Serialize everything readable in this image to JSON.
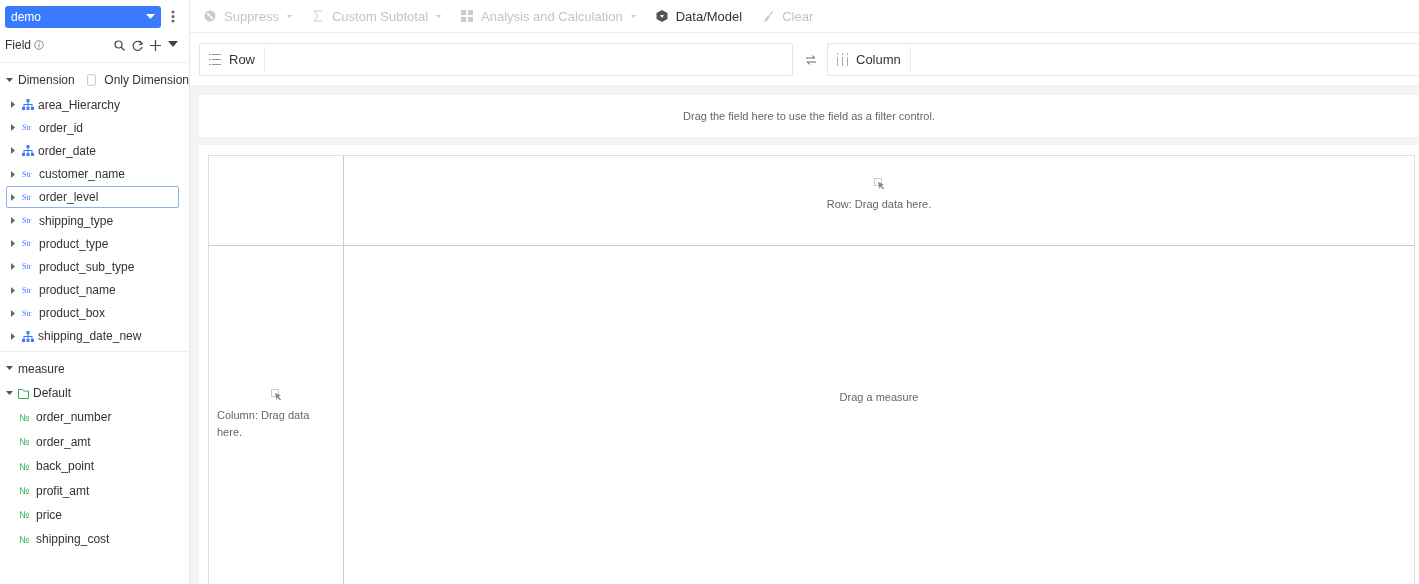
{
  "dataset": {
    "value": "demo"
  },
  "toolbar": [
    {
      "label": "Suppress",
      "kind": "menu",
      "disabled": true
    },
    {
      "label": "Custom Subtotal",
      "kind": "menu",
      "disabled": true
    },
    {
      "label": "Analysis and Calculation",
      "kind": "menu",
      "disabled": true
    },
    {
      "label": "Data/Model",
      "kind": "button",
      "disabled": false
    },
    {
      "label": "Clear",
      "kind": "button",
      "disabled": true
    }
  ],
  "field_panel": {
    "title": "Field"
  },
  "dimension": {
    "label": "Dimension",
    "expanded": true,
    "only_dimension": {
      "label": "Only Dimension",
      "checked": false
    },
    "items": [
      {
        "name": "area_Hierarchy",
        "kind": "hierarchy",
        "expanded": false,
        "selected": false
      },
      {
        "name": "order_id",
        "kind": "string",
        "type_mark": "Str",
        "expanded": false,
        "selected": false
      },
      {
        "name": "order_date",
        "kind": "hierarchy",
        "expanded": false,
        "selected": false
      },
      {
        "name": "customer_name",
        "kind": "string",
        "type_mark": "Str",
        "expanded": false,
        "selected": false
      },
      {
        "name": "order_level",
        "kind": "string",
        "type_mark": "Str",
        "expanded": false,
        "selected": true
      },
      {
        "name": "shipping_type",
        "kind": "string",
        "type_mark": "Str",
        "expanded": false,
        "selected": false
      },
      {
        "name": "product_type",
        "kind": "string",
        "type_mark": "Str",
        "expanded": false,
        "selected": false
      },
      {
        "name": "product_sub_type",
        "kind": "string",
        "type_mark": "Str",
        "expanded": false,
        "selected": false
      },
      {
        "name": "product_name",
        "kind": "string",
        "type_mark": "Str",
        "expanded": false,
        "selected": false
      },
      {
        "name": "product_box",
        "kind": "string",
        "type_mark": "Str",
        "expanded": false,
        "selected": false
      },
      {
        "name": "shipping_date_new",
        "kind": "hierarchy",
        "expanded": false,
        "selected": false
      }
    ]
  },
  "measure": {
    "label": "measure",
    "expanded": true,
    "folders": [
      {
        "name": "Default",
        "expanded": true,
        "items": [
          {
            "name": "order_number",
            "type_mark": "№"
          },
          {
            "name": "order_amt",
            "type_mark": "№"
          },
          {
            "name": "back_point",
            "type_mark": "№"
          },
          {
            "name": "profit_amt",
            "type_mark": "№"
          },
          {
            "name": "price",
            "type_mark": "№"
          },
          {
            "name": "shipping_cost",
            "type_mark": "№"
          }
        ]
      }
    ]
  },
  "shelves": {
    "row": {
      "label": "Row"
    },
    "column": {
      "label": "Column"
    }
  },
  "filter_hint": "Drag the field here to use the field as a filter control.",
  "pivot": {
    "row_hint": "Row: Drag data here.",
    "column_hint": "Column: Drag data here.",
    "measure_hint": "Drag a measure"
  }
}
